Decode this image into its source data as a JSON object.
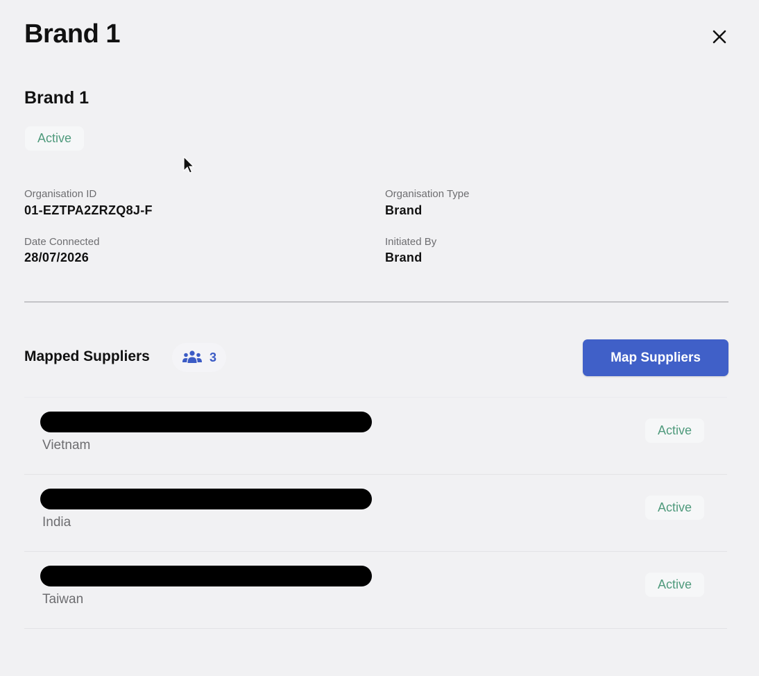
{
  "panel": {
    "title": "Brand 1",
    "close_icon": "close-icon"
  },
  "organisation": {
    "name": "Brand 1",
    "status": "Active",
    "status_color": "#4f9a7c",
    "fields": {
      "org_id_label": "Organisation ID",
      "org_id_value": "01-EZTPA2ZRZQ8J-F",
      "org_type_label": "Organisation Type",
      "org_type_value": "Brand",
      "date_connected_label": "Date Connected",
      "date_connected_value": "28/07/2026",
      "initiated_by_label": "Initiated By",
      "initiated_by_value": "Brand"
    }
  },
  "mapped_suppliers": {
    "title": "Mapped Suppliers",
    "count_icon": "users-icon",
    "count": "3",
    "map_button_label": "Map Suppliers",
    "accent_color": "#4060c8",
    "items": [
      {
        "name": "",
        "country": "Vietnam",
        "status": "Active"
      },
      {
        "name": "",
        "country": "India",
        "status": "Active"
      },
      {
        "name": "",
        "country": "Taiwan",
        "status": "Active"
      }
    ]
  }
}
